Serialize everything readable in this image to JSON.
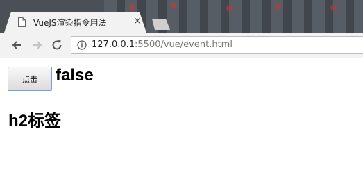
{
  "browser": {
    "tab": {
      "title": "VueJS渲染指令用法",
      "close_glyph": "×",
      "favicon_icon": "document-icon"
    },
    "new_tab_icon": "new-tab-icon",
    "nav": {
      "back_icon": "arrow-left-icon",
      "forward_icon": "arrow-right-icon",
      "reload_icon": "reload-icon"
    },
    "address": {
      "info_icon": "info-icon",
      "host": "127.0.0.1",
      "rest": ":5500/vue/event.html"
    }
  },
  "page": {
    "button_label": "点击",
    "bool_value": "false",
    "heading": "h2标签"
  },
  "colors": {
    "tab_strip": "#4a5056",
    "toolbar": "#f2f2f2",
    "button_border": "#7aa0d0",
    "url_rest": "#777777"
  }
}
